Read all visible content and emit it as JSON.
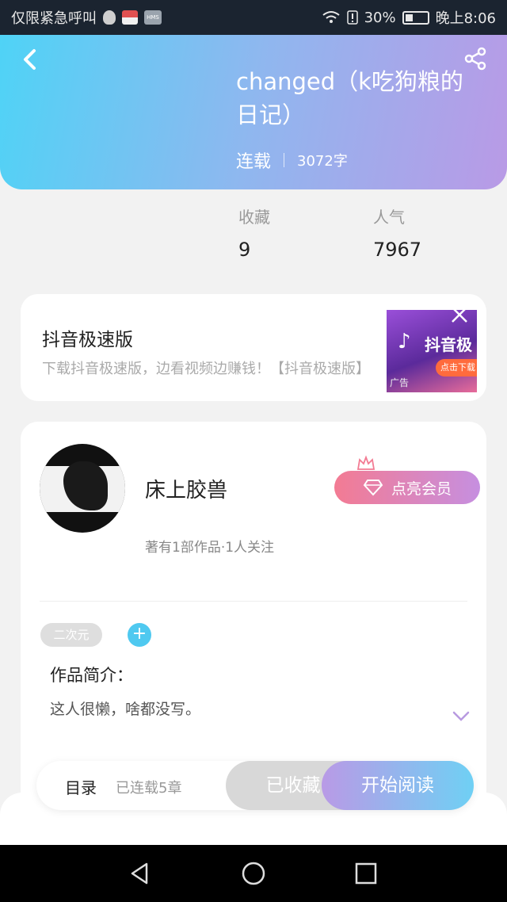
{
  "status_bar": {
    "carrier": "仅限紧急呼叫",
    "battery": "30%",
    "time": "晚上8:06",
    "icons": [
      "qq-icon",
      "app-icon",
      "hms-icon",
      "wifi-icon",
      "alert-icon",
      "battery-icon"
    ]
  },
  "header": {
    "title": "changed（k吃狗粮的日记）",
    "status": "连载",
    "words": "3072字",
    "colors": {
      "gradient_start": "#4fd3f6",
      "gradient_end": "#b99ae6"
    }
  },
  "stats": {
    "favorites_label": "收藏",
    "favorites_value": "9",
    "popularity_label": "人气",
    "popularity_value": "7967"
  },
  "ad": {
    "title": "抖音极速版",
    "description": "下载抖音极速版，边看视频边赚钱！【抖音极速版】",
    "image_text": "抖音极",
    "image_button": "点击下载",
    "tag": "广告"
  },
  "author": {
    "name": "床上胶兽",
    "subtitle": "著有1部作品·1人关注",
    "vip_label": "点亮会员"
  },
  "work": {
    "tag": "二次元",
    "add_tag": "+",
    "intro_title": "作品简介：",
    "intro_text": "这人很懒，啥都没写。"
  },
  "actions": {
    "toc_label": "目录",
    "toc_sub": "已连载5章",
    "collected": "已收藏",
    "read": "开始阅读"
  }
}
